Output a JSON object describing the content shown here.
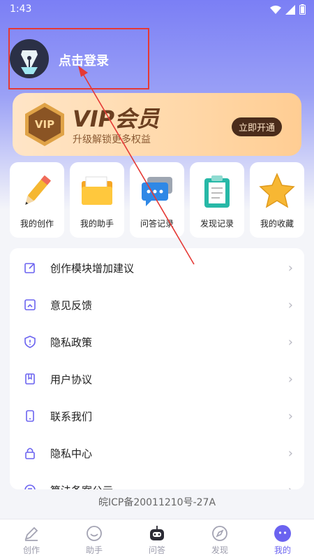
{
  "status": {
    "time": "1:43"
  },
  "profile": {
    "login_label": "点击登录"
  },
  "vip": {
    "badge": "VIP",
    "title": "VIP会员",
    "subtitle": "升级解锁更多权益",
    "button": "立即开通"
  },
  "features": [
    {
      "label": "我的创作",
      "icon": "pencil-icon"
    },
    {
      "label": "我的助手",
      "icon": "folder-icon"
    },
    {
      "label": "问答记录",
      "icon": "chat-bubble-icon"
    },
    {
      "label": "发现记录",
      "icon": "clipboard-icon"
    },
    {
      "label": "我的收藏",
      "icon": "star-icon"
    }
  ],
  "menu": [
    {
      "label": "创作模块增加建议",
      "icon": "edit-square-icon"
    },
    {
      "label": "意见反馈",
      "icon": "feedback-icon"
    },
    {
      "label": "隐私政策",
      "icon": "shield-icon"
    },
    {
      "label": "用户协议",
      "icon": "bookmark-icon"
    },
    {
      "label": "联系我们",
      "icon": "phone-icon"
    },
    {
      "label": "隐私中心",
      "icon": "lock-icon"
    },
    {
      "label": "算法备案公示",
      "icon": "algorithm-icon"
    }
  ],
  "icp": "皖ICP备20011210号-27A",
  "tabs": [
    {
      "label": "创作",
      "icon": "pen-icon",
      "active": false
    },
    {
      "label": "助手",
      "icon": "smile-icon",
      "active": false
    },
    {
      "label": "问答",
      "icon": "robot-icon",
      "active": false
    },
    {
      "label": "发现",
      "icon": "compass-icon",
      "active": false
    },
    {
      "label": "我的",
      "icon": "profile-icon",
      "active": true
    }
  ],
  "colors": {
    "accent": "#6b63f0",
    "highlight_frame": "#e53935",
    "vip_dark": "#4a2c1b"
  }
}
